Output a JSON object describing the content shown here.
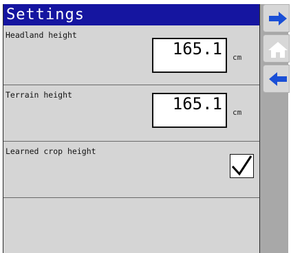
{
  "header": {
    "title": "Settings"
  },
  "rows": [
    {
      "label": "Headland height",
      "value": "165.1",
      "unit": "cm"
    },
    {
      "label": "Terrain height",
      "value": "165.1",
      "unit": "cm"
    },
    {
      "label": "Learned crop height",
      "checked": true
    }
  ],
  "sidebar": {
    "buttons": [
      {
        "icon": "arrow-right-icon"
      },
      {
        "icon": "home-icon"
      },
      {
        "icon": "arrow-left-icon"
      }
    ]
  },
  "colors": {
    "titlebar": "#1515a0",
    "arrow": "#1a4fd6",
    "background": "#d5d5d5"
  }
}
